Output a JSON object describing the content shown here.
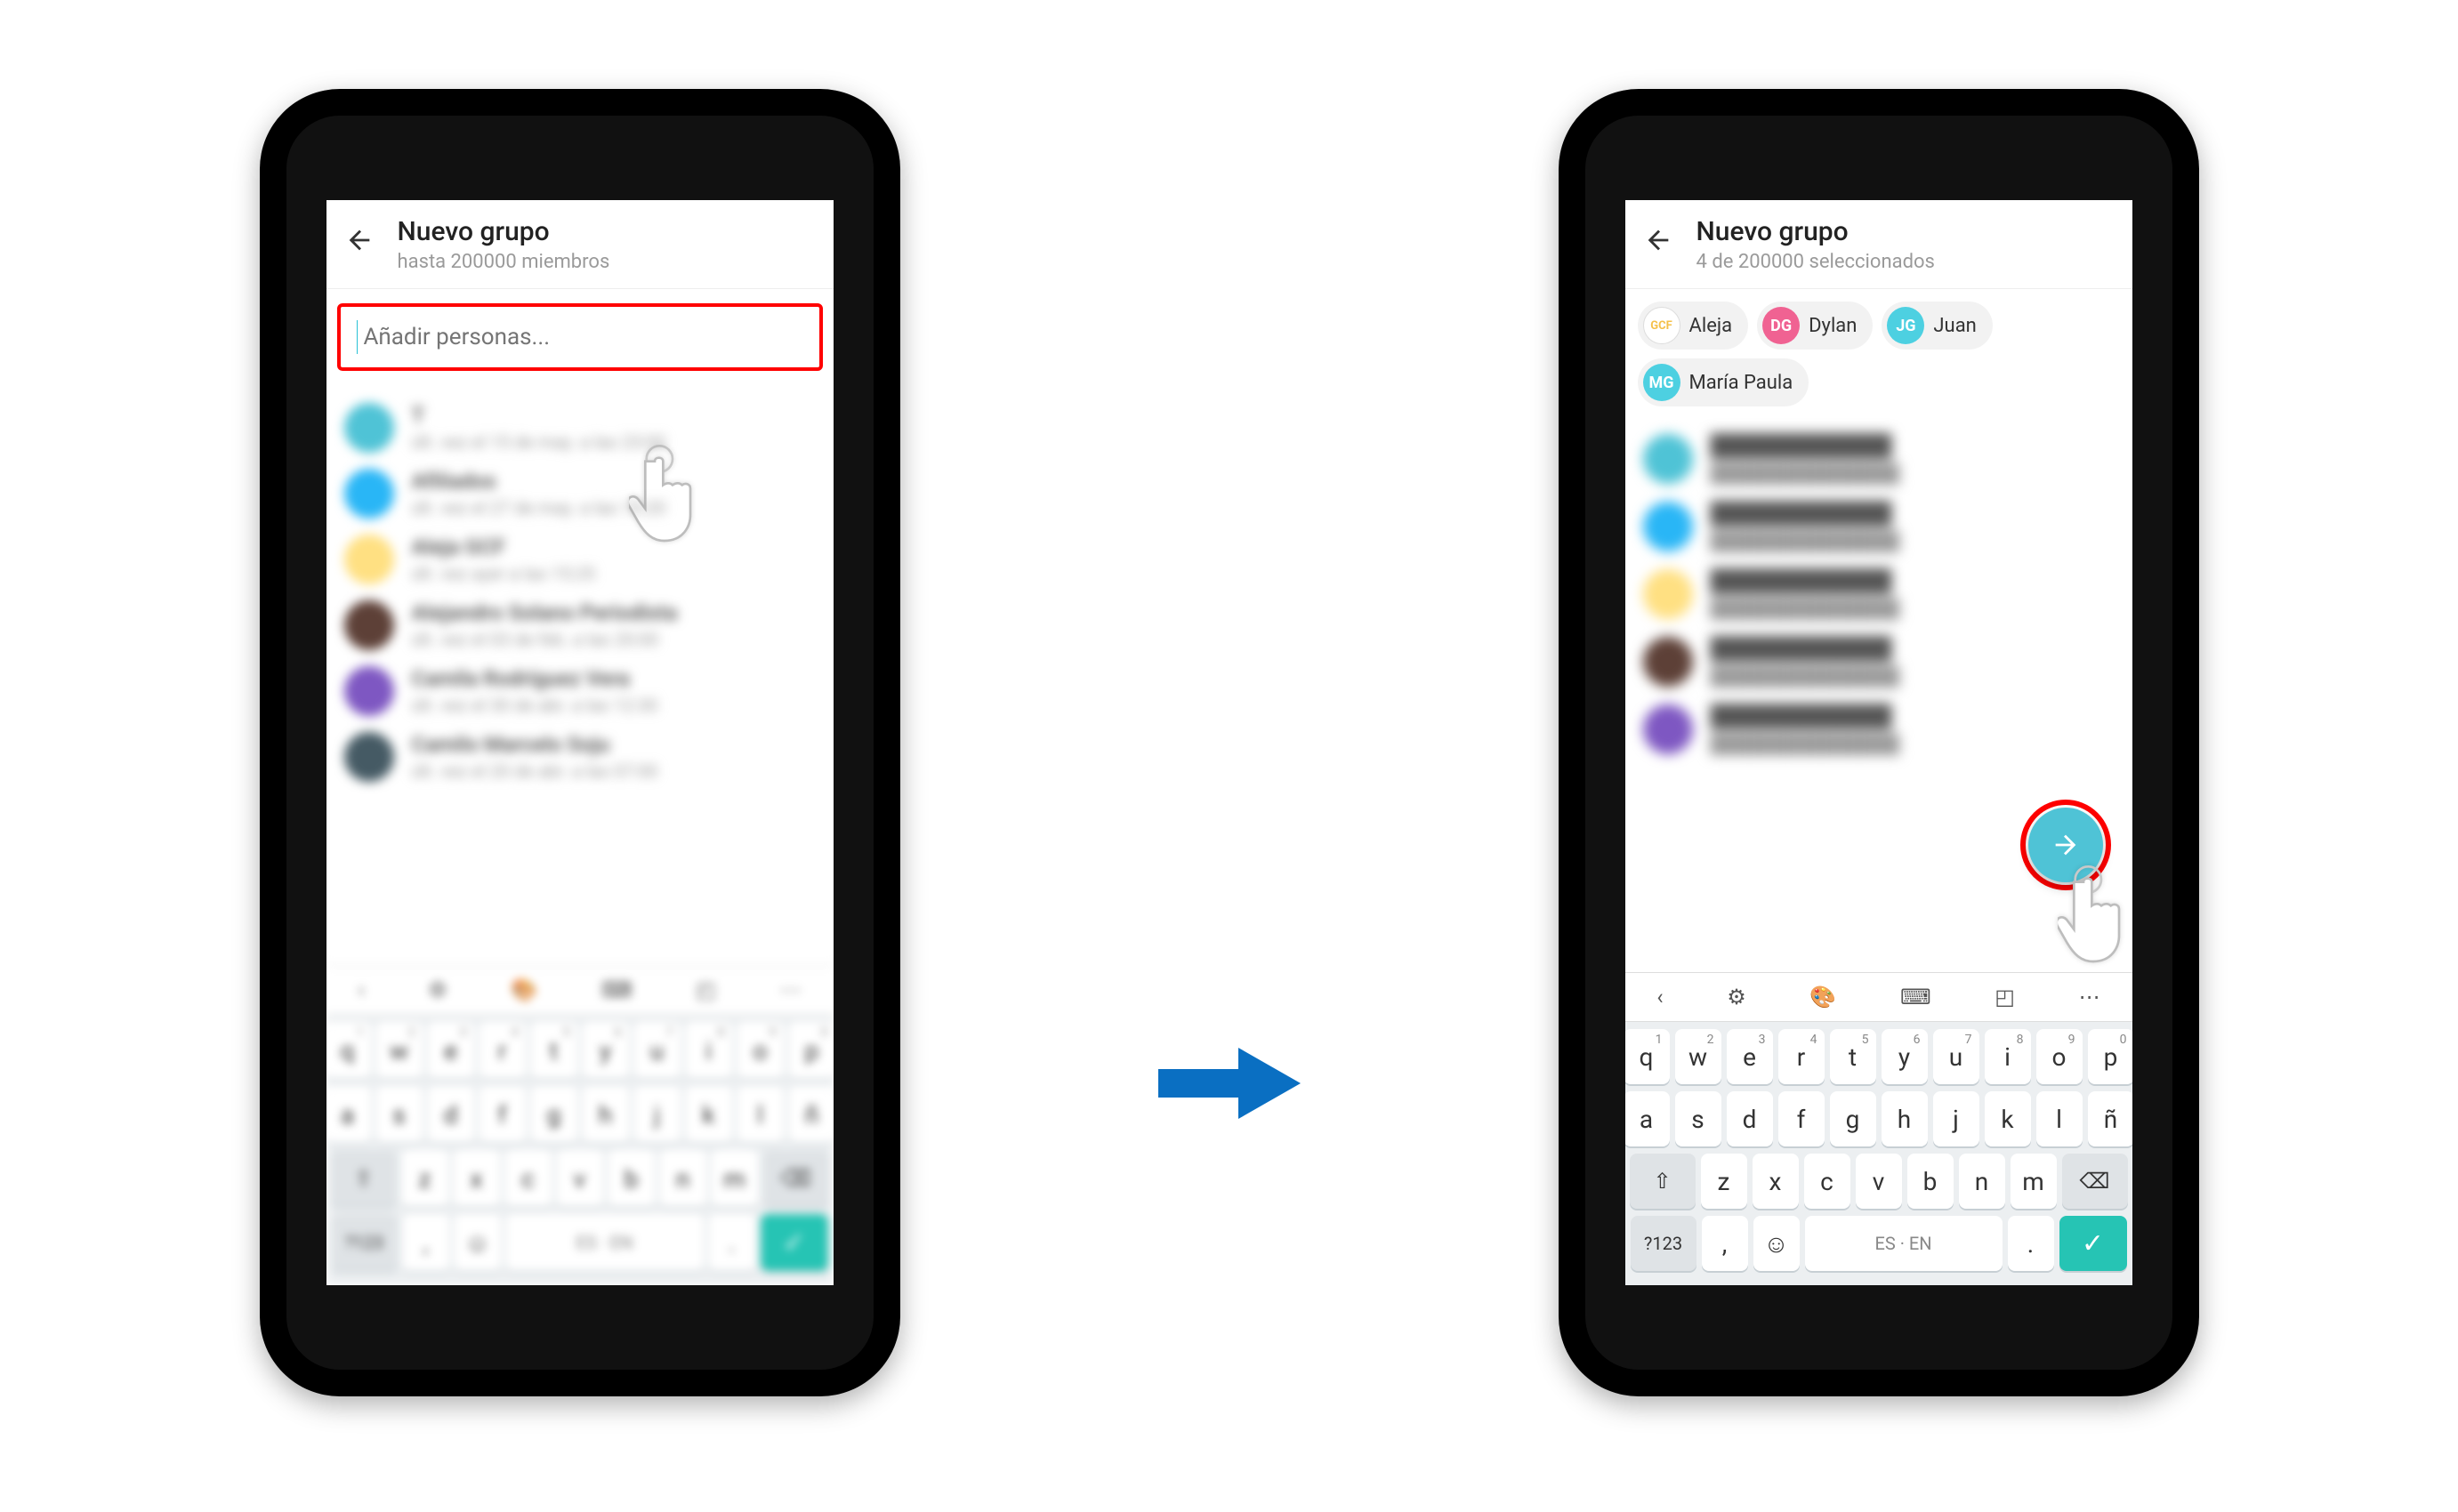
{
  "colors": {
    "highlight_red": "#ff0000",
    "accent_cyan": "#4fc3d6",
    "arrow_blue": "#0a6fc2",
    "enter_green": "#26c4b4",
    "chip_pink": "#f06292",
    "chip_cyan": "#4dd0e1"
  },
  "left": {
    "header": {
      "title": "Nuevo grupo",
      "subtitle": "hasta 200000 miembros"
    },
    "search": {
      "placeholder": "Añadir personas..."
    },
    "contacts": [
      {
        "name": "T",
        "sub": "últ. vez el 15 de may. a las 23:00",
        "color": "#4fc3d6"
      },
      {
        "name": "Afiliados",
        "sub": "últ. vez el 27 de may. a las 10:20",
        "color": "#29b6f6"
      },
      {
        "name": "Aleja GCF",
        "sub": "últ. vez ayer a las 15:25",
        "color": "#ffe082"
      },
      {
        "name": "Alejandro Solano Periodista",
        "sub": "últ. vez el 03 de feb. a las 20:00",
        "color": "#5d4037"
      },
      {
        "name": "Camila Rodríguez Vera",
        "sub": "últ. vez el 30 de abr. a las 12:30",
        "color": "#7e57c2"
      },
      {
        "name": "Camilo Marcelo Soju",
        "sub": "últ. vez el 20 de abr. a las 07:00",
        "color": "#455a64"
      }
    ]
  },
  "right": {
    "header": {
      "title": "Nuevo grupo",
      "subtitle": "4 de 200000 seleccionados"
    },
    "chips": [
      {
        "name": "Aleja",
        "avatar_label": "GCF",
        "avatar_bg": "#ffffff",
        "avatar_fg": "#f5c04a",
        "border": true
      },
      {
        "name": "Dylan",
        "avatar_label": "DG",
        "avatar_bg": "#f06292",
        "avatar_fg": "#ffffff"
      },
      {
        "name": "Juan",
        "avatar_label": "JG",
        "avatar_bg": "#4dd0e1",
        "avatar_fg": "#ffffff"
      },
      {
        "name": "María Paula",
        "avatar_label": "MG",
        "avatar_bg": "#4dd0e1",
        "avatar_fg": "#ffffff"
      }
    ],
    "contacts": [
      {
        "color": "#4fc3d6"
      },
      {
        "color": "#29b6f6"
      },
      {
        "color": "#ffe082"
      },
      {
        "color": "#5d4037"
      },
      {
        "color": "#7e57c2"
      }
    ],
    "fab_icon": "arrow-right"
  },
  "keyboard": {
    "toolbar_icons": [
      "chevron-left",
      "gear",
      "palette",
      "keyboard",
      "sticker",
      "more"
    ],
    "row1": [
      {
        "k": "q",
        "s": "1"
      },
      {
        "k": "w",
        "s": "2"
      },
      {
        "k": "e",
        "s": "3"
      },
      {
        "k": "r",
        "s": "4"
      },
      {
        "k": "t",
        "s": "5"
      },
      {
        "k": "y",
        "s": "6"
      },
      {
        "k": "u",
        "s": "7"
      },
      {
        "k": "i",
        "s": "8"
      },
      {
        "k": "o",
        "s": "9"
      },
      {
        "k": "p",
        "s": "0"
      }
    ],
    "row2": [
      "a",
      "s",
      "d",
      "f",
      "g",
      "h",
      "j",
      "k",
      "l",
      "ñ"
    ],
    "row3": {
      "shift": "⇧",
      "keys": [
        "z",
        "x",
        "c",
        "v",
        "b",
        "n",
        "m"
      ],
      "backspace": "⌫"
    },
    "row4": {
      "symbols": "?123",
      "comma": ",",
      "emoji": "☺",
      "space": "ES · EN",
      "period": ".",
      "enter": "✓"
    }
  }
}
